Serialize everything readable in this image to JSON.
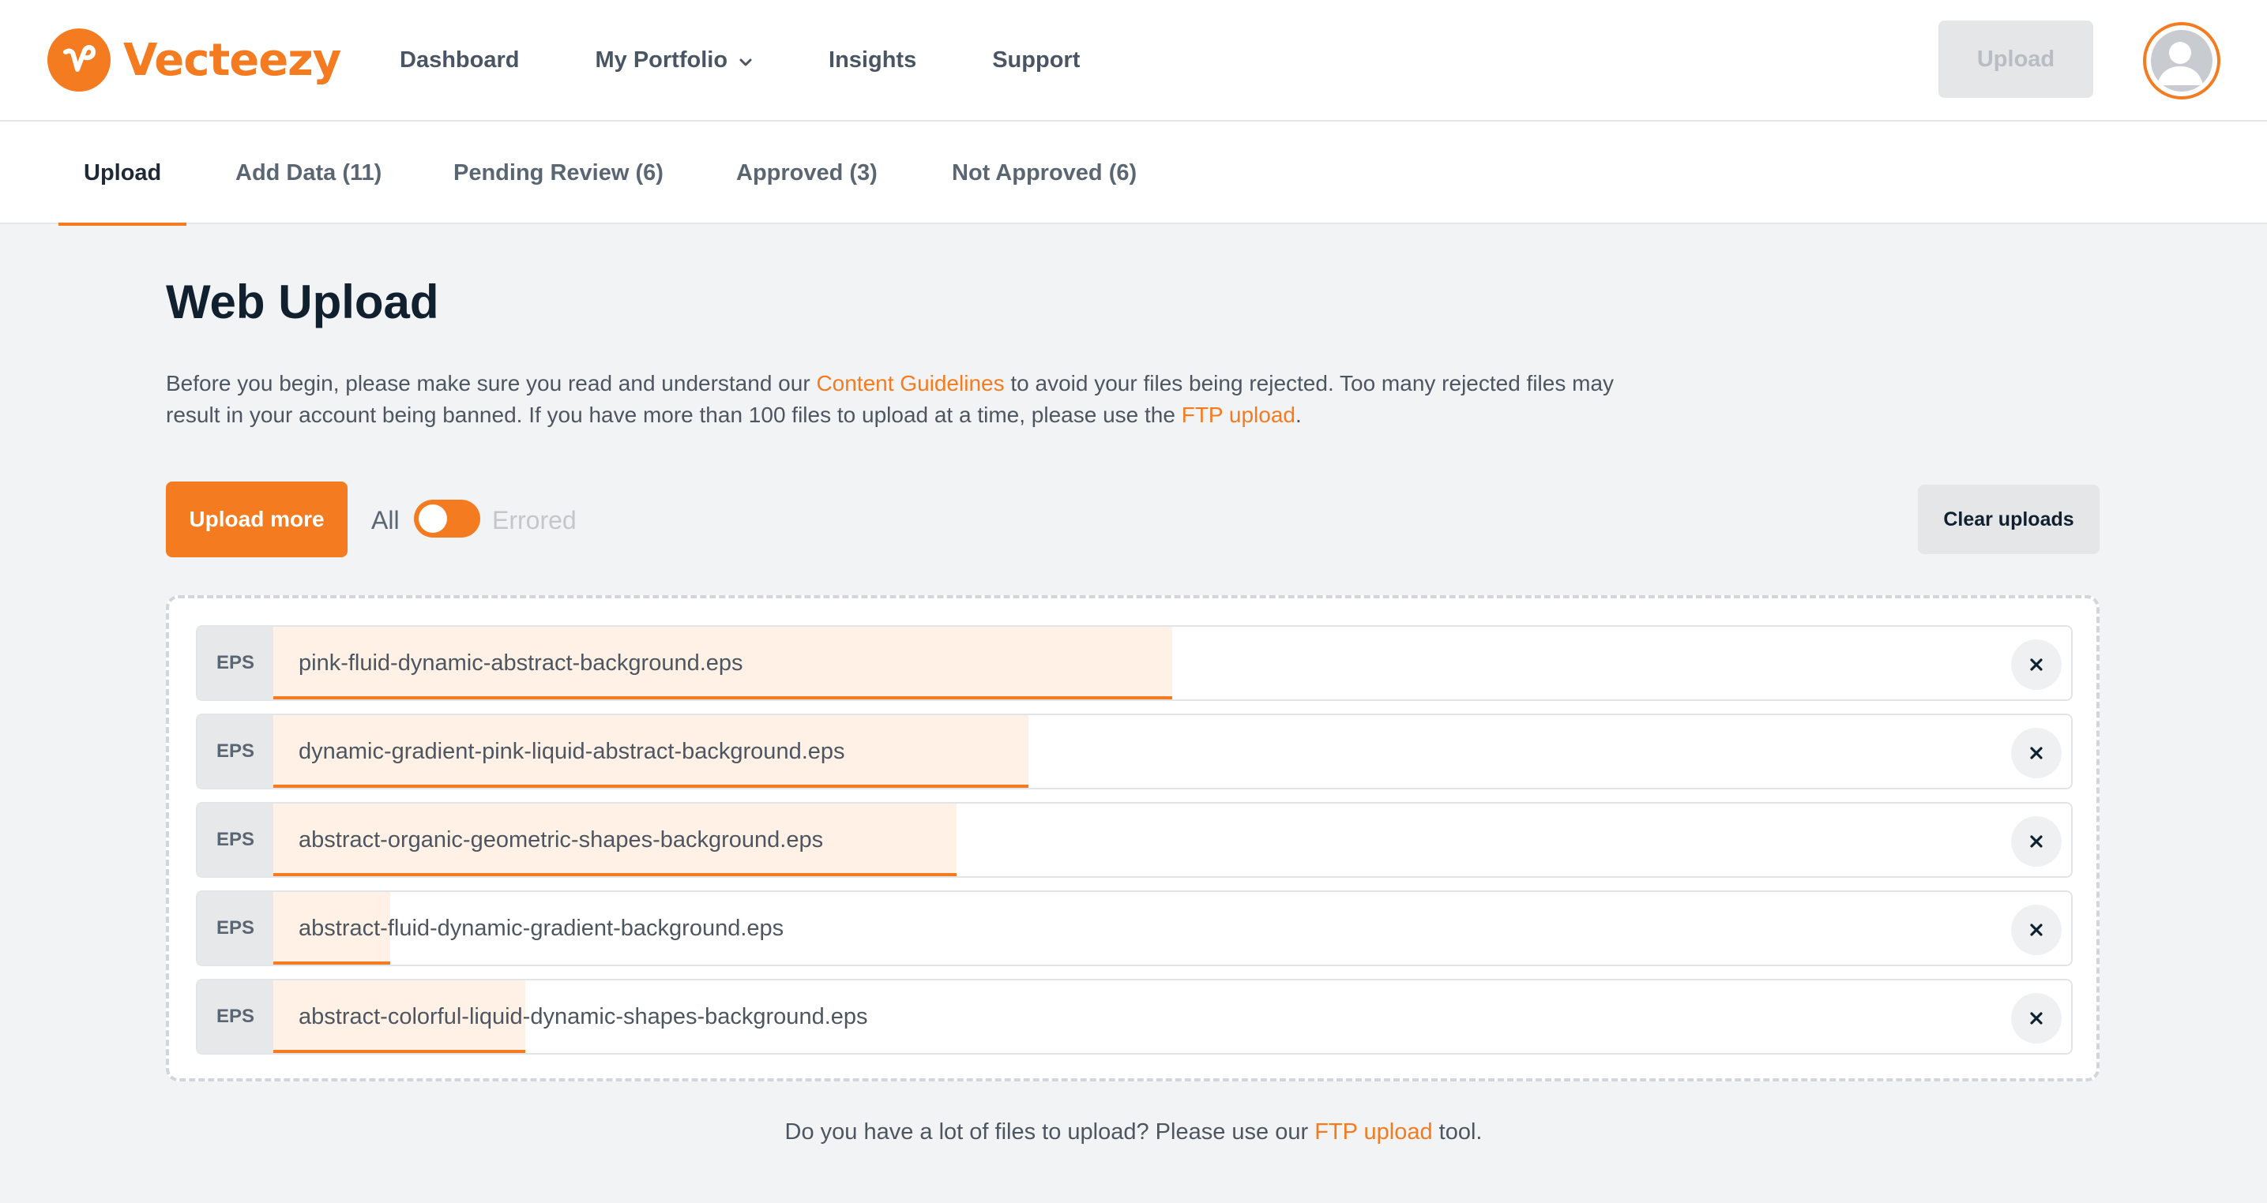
{
  "brand": {
    "name": "Vecteezy",
    "logo_icon": "vecteezy-v-logo-icon",
    "accent": "#f47b20"
  },
  "nav": {
    "items": [
      {
        "label": "Dashboard"
      },
      {
        "label": "My Portfolio",
        "icon": "chevron-down-icon"
      },
      {
        "label": "Insights"
      },
      {
        "label": "Support"
      }
    ],
    "upload_label": "Upload",
    "avatar_icon": "user-avatar-icon"
  },
  "tabs": [
    {
      "label": "Upload",
      "active": true
    },
    {
      "label": "Add Data (11)"
    },
    {
      "label": "Pending Review (6)"
    },
    {
      "label": "Approved (3)"
    },
    {
      "label": "Not Approved (6)"
    }
  ],
  "main": {
    "title": "Web Upload",
    "intro": {
      "part1": "Before you begin, please make sure you read and understand our ",
      "link1": "Content Guidelines",
      "part2": " to avoid your files being rejected. Too many rejected files may result in your account being banned. If you have more than 100 files to upload at a time, please use the ",
      "link2": "FTP upload",
      "part3": "."
    },
    "upload_more_label": "Upload more",
    "filter": {
      "left_label": "All",
      "right_label": "Errored"
    },
    "clear_label": "Clear uploads",
    "files": [
      {
        "type": "EPS",
        "name": "pink-fluid-dynamic-abstract-background.eps",
        "progress": 0.5
      },
      {
        "type": "EPS",
        "name": "dynamic-gradient-pink-liquid-abstract-background.eps",
        "progress": 0.42
      },
      {
        "type": "EPS",
        "name": "abstract-organic-geometric-shapes-background.eps",
        "progress": 0.38
      },
      {
        "type": "EPS",
        "name": "abstract-fluid-dynamic-gradient-background.eps",
        "progress": 0.065
      },
      {
        "type": "EPS",
        "name": "abstract-colorful-liquid-dynamic-shapes-background.eps",
        "progress": 0.14
      }
    ],
    "remove_icon": "close-icon"
  },
  "footer": {
    "part1": "Do you have a lot of files to upload? Please use our ",
    "link": "FTP upload",
    "part2": " tool."
  }
}
